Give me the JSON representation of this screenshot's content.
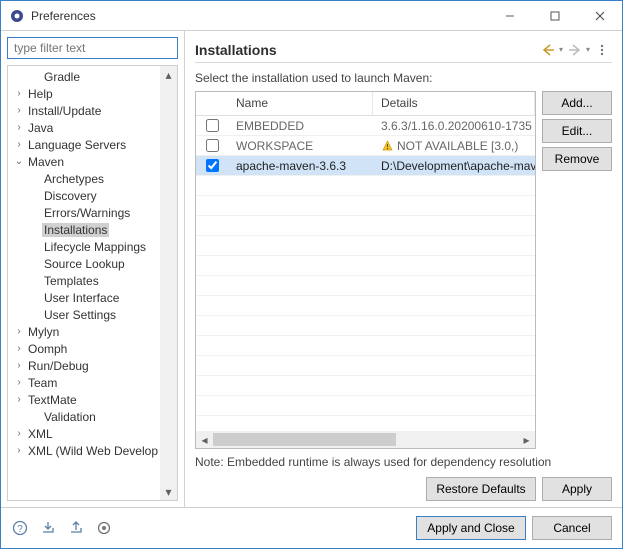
{
  "window": {
    "title": "Preferences"
  },
  "filter": {
    "placeholder": "type filter text"
  },
  "tree": {
    "items": [
      {
        "label": "Gradle",
        "expand": "",
        "depth": 1
      },
      {
        "label": "Help",
        "expand": "›",
        "depth": 0
      },
      {
        "label": "Install/Update",
        "expand": "›",
        "depth": 0
      },
      {
        "label": "Java",
        "expand": "›",
        "depth": 0
      },
      {
        "label": "Language Servers",
        "expand": "›",
        "depth": 0
      },
      {
        "label": "Maven",
        "expand": "⌄",
        "depth": 0
      },
      {
        "label": "Archetypes",
        "expand": "",
        "depth": 1
      },
      {
        "label": "Discovery",
        "expand": "",
        "depth": 1
      },
      {
        "label": "Errors/Warnings",
        "expand": "",
        "depth": 1
      },
      {
        "label": "Installations",
        "expand": "",
        "depth": 1,
        "selected": true
      },
      {
        "label": "Lifecycle Mappings",
        "expand": "",
        "depth": 1
      },
      {
        "label": "Source Lookup",
        "expand": "",
        "depth": 1
      },
      {
        "label": "Templates",
        "expand": "",
        "depth": 1
      },
      {
        "label": "User Interface",
        "expand": "",
        "depth": 1
      },
      {
        "label": "User Settings",
        "expand": "",
        "depth": 1
      },
      {
        "label": "Mylyn",
        "expand": "›",
        "depth": 0
      },
      {
        "label": "Oomph",
        "expand": "›",
        "depth": 0
      },
      {
        "label": "Run/Debug",
        "expand": "›",
        "depth": 0
      },
      {
        "label": "Team",
        "expand": "›",
        "depth": 0
      },
      {
        "label": "TextMate",
        "expand": "›",
        "depth": 0
      },
      {
        "label": "Validation",
        "expand": "",
        "depth": 1
      },
      {
        "label": "XML",
        "expand": "›",
        "depth": 0
      },
      {
        "label": "XML (Wild Web Develop",
        "expand": "›",
        "depth": 0
      }
    ]
  },
  "page": {
    "title": "Installations",
    "subhead": "Select the installation used to launch Maven:",
    "columns": {
      "name": "Name",
      "details": "Details"
    },
    "rows": [
      {
        "checked": false,
        "name": "EMBEDDED",
        "details": "3.6.3/1.16.0.20200610-1735",
        "grey": true,
        "warn": false
      },
      {
        "checked": false,
        "name": "WORKSPACE",
        "details": "NOT AVAILABLE [3.0,)",
        "grey": true,
        "warn": true
      },
      {
        "checked": true,
        "name": "apache-maven-3.6.3",
        "details": "D:\\Development\\apache-maven-",
        "grey": false,
        "warn": false,
        "selected": true
      }
    ],
    "note": "Note: Embedded runtime is always used for dependency resolution",
    "buttons": {
      "add": "Add...",
      "edit": "Edit...",
      "remove": "Remove",
      "restore": "Restore Defaults",
      "apply": "Apply"
    }
  },
  "footer": {
    "apply_close": "Apply and Close",
    "cancel": "Cancel"
  }
}
